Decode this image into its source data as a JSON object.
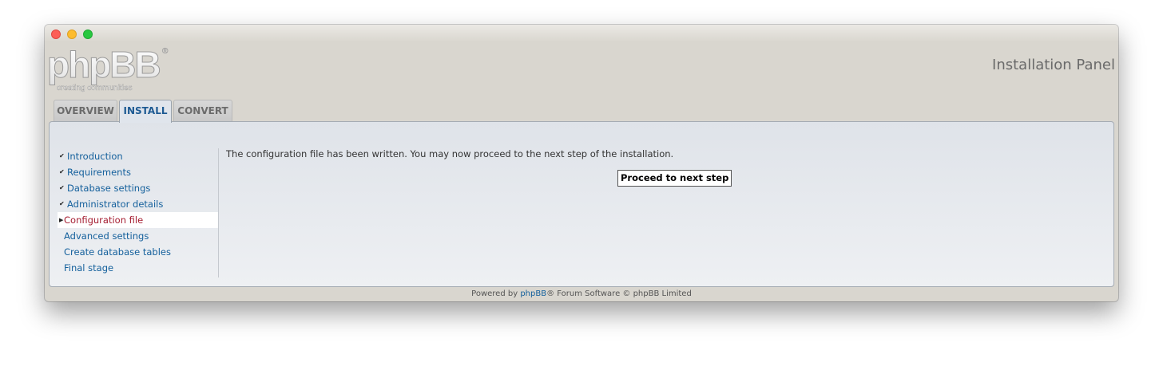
{
  "window": {
    "title_buttons": [
      "close",
      "minimize",
      "zoom"
    ]
  },
  "header": {
    "logo_text": "phpBB",
    "logo_tagline": "creating communities",
    "panel_title": "Installation Panel"
  },
  "tabs": [
    {
      "label": "OVERVIEW",
      "active": false
    },
    {
      "label": "INSTALL",
      "active": true
    },
    {
      "label": "CONVERT",
      "active": false
    }
  ],
  "menu": {
    "items": [
      {
        "label": "Introduction",
        "state": "done"
      },
      {
        "label": "Requirements",
        "state": "done"
      },
      {
        "label": "Database settings",
        "state": "done"
      },
      {
        "label": "Administrator details",
        "state": "done"
      },
      {
        "label": "Configuration file",
        "state": "current"
      },
      {
        "label": "Advanced settings",
        "state": "pending"
      },
      {
        "label": "Create database tables",
        "state": "pending"
      },
      {
        "label": "Final stage",
        "state": "pending"
      }
    ]
  },
  "main": {
    "message": "The configuration file has been written. You may now proceed to the next step of the installation.",
    "proceed_label": "Proceed to next step"
  },
  "footer": {
    "prefix": "Powered by ",
    "link": "phpBB",
    "suffix": "® Forum Software © phpBB Limited"
  },
  "colors": {
    "link": "#14609c",
    "current": "#a51c30",
    "tab_active_text": "#1d5a93"
  }
}
